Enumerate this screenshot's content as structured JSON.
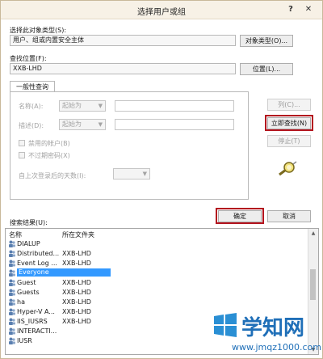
{
  "dialog": {
    "title": "选择用户或组",
    "help_symbol": "?",
    "close_symbol": "✕"
  },
  "object_type": {
    "label": "选择此对象类型(S):",
    "value": "用户、组或内置安全主体",
    "button": "对象类型(O)..."
  },
  "location": {
    "label": "查找位置(F):",
    "value": "XXB-LHD",
    "button": "位置(L)..."
  },
  "query": {
    "tab_label": "一般性查询",
    "name_label": "名称(A):",
    "name_match": "起始为",
    "desc_label": "描述(D):",
    "desc_match": "起始为",
    "disabled_accounts": "禁用的帐户(B)",
    "nonexpiring_pw": "不过期密码(X)",
    "days_since_logon": "自上次登录后的天数(I):"
  },
  "side_buttons": {
    "columns": "列(C)...",
    "find_now": "立即查找(N)",
    "stop": "停止(T)"
  },
  "footer": {
    "ok": "确定",
    "cancel": "取消"
  },
  "results": {
    "label": "搜索结果(U):",
    "columns": {
      "name": "名称",
      "folder": "所在文件夹"
    },
    "rows": [
      {
        "name": "DIALUP",
        "folder": ""
      },
      {
        "name": "Distributed...",
        "folder": "XXB-LHD"
      },
      {
        "name": "Event Log ...",
        "folder": "XXB-LHD"
      },
      {
        "name": "Everyone",
        "folder": ""
      },
      {
        "name": "Guest",
        "folder": "XXB-LHD"
      },
      {
        "name": "Guests",
        "folder": "XXB-LHD"
      },
      {
        "name": "ha",
        "folder": "XXB-LHD"
      },
      {
        "name": "Hyper-V A...",
        "folder": "XXB-LHD"
      },
      {
        "name": "IIS_IUSRS",
        "folder": "XXB-LHD"
      },
      {
        "name": "INTERACTI...",
        "folder": ""
      },
      {
        "name": "IUSR",
        "folder": ""
      }
    ],
    "selected_index": 3
  },
  "watermark": {
    "brand": "学知网",
    "url": "www.jmqz1000.com"
  },
  "colors": {
    "highlight_border": "#b3141e",
    "selection": "#3399ff",
    "titlebar": "#f7f1e6"
  }
}
